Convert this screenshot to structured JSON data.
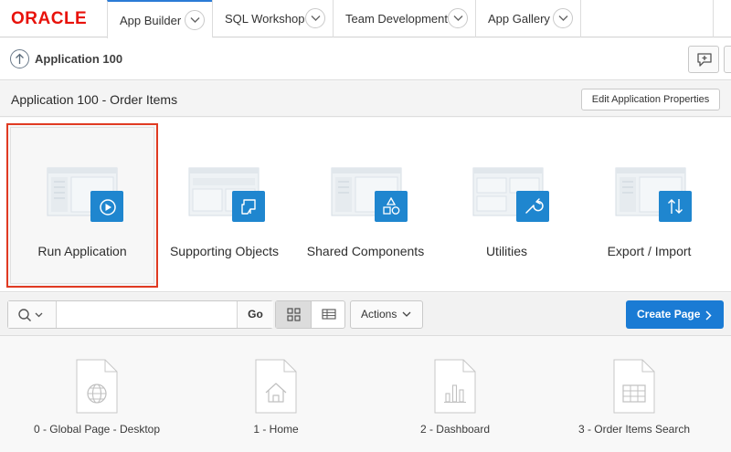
{
  "header": {
    "logo": "ORACLE",
    "tabs": [
      {
        "label": "App Builder",
        "active": true
      },
      {
        "label": "SQL Workshop",
        "active": false
      },
      {
        "label": "Team Development",
        "active": false
      },
      {
        "label": "App Gallery",
        "active": false
      }
    ]
  },
  "breadcrumb": {
    "label": "Application 100"
  },
  "title_bar": {
    "title": "Application 100 - Order Items",
    "edit_button": "Edit Application Properties"
  },
  "tiles": [
    {
      "label": "Run Application",
      "icon": "play-icon",
      "selected": true
    },
    {
      "label": "Supporting Objects",
      "icon": "script-icon",
      "selected": false
    },
    {
      "label": "Shared Components",
      "icon": "shapes-icon",
      "selected": false
    },
    {
      "label": "Utilities",
      "icon": "wrench-icon",
      "selected": false
    },
    {
      "label": "Export / Import",
      "icon": "arrows-updown-icon",
      "selected": false
    }
  ],
  "toolbar": {
    "search_value": "",
    "go_label": "Go",
    "view_mode": "grid",
    "actions_label": "Actions",
    "create_label": "Create Page"
  },
  "pages": [
    {
      "label": "0 - Global Page - Desktop",
      "icon": "globe-icon"
    },
    {
      "label": "1 - Home",
      "icon": "home-icon"
    },
    {
      "label": "2 - Dashboard",
      "icon": "bar-chart-icon"
    },
    {
      "label": "3 - Order Items Search",
      "icon": "table-icon"
    }
  ],
  "colors": {
    "accent": "#1a7bd4",
    "tile_icon": "#1f86cf",
    "selection_border": "#e03a22",
    "logo": "#e8120b"
  }
}
